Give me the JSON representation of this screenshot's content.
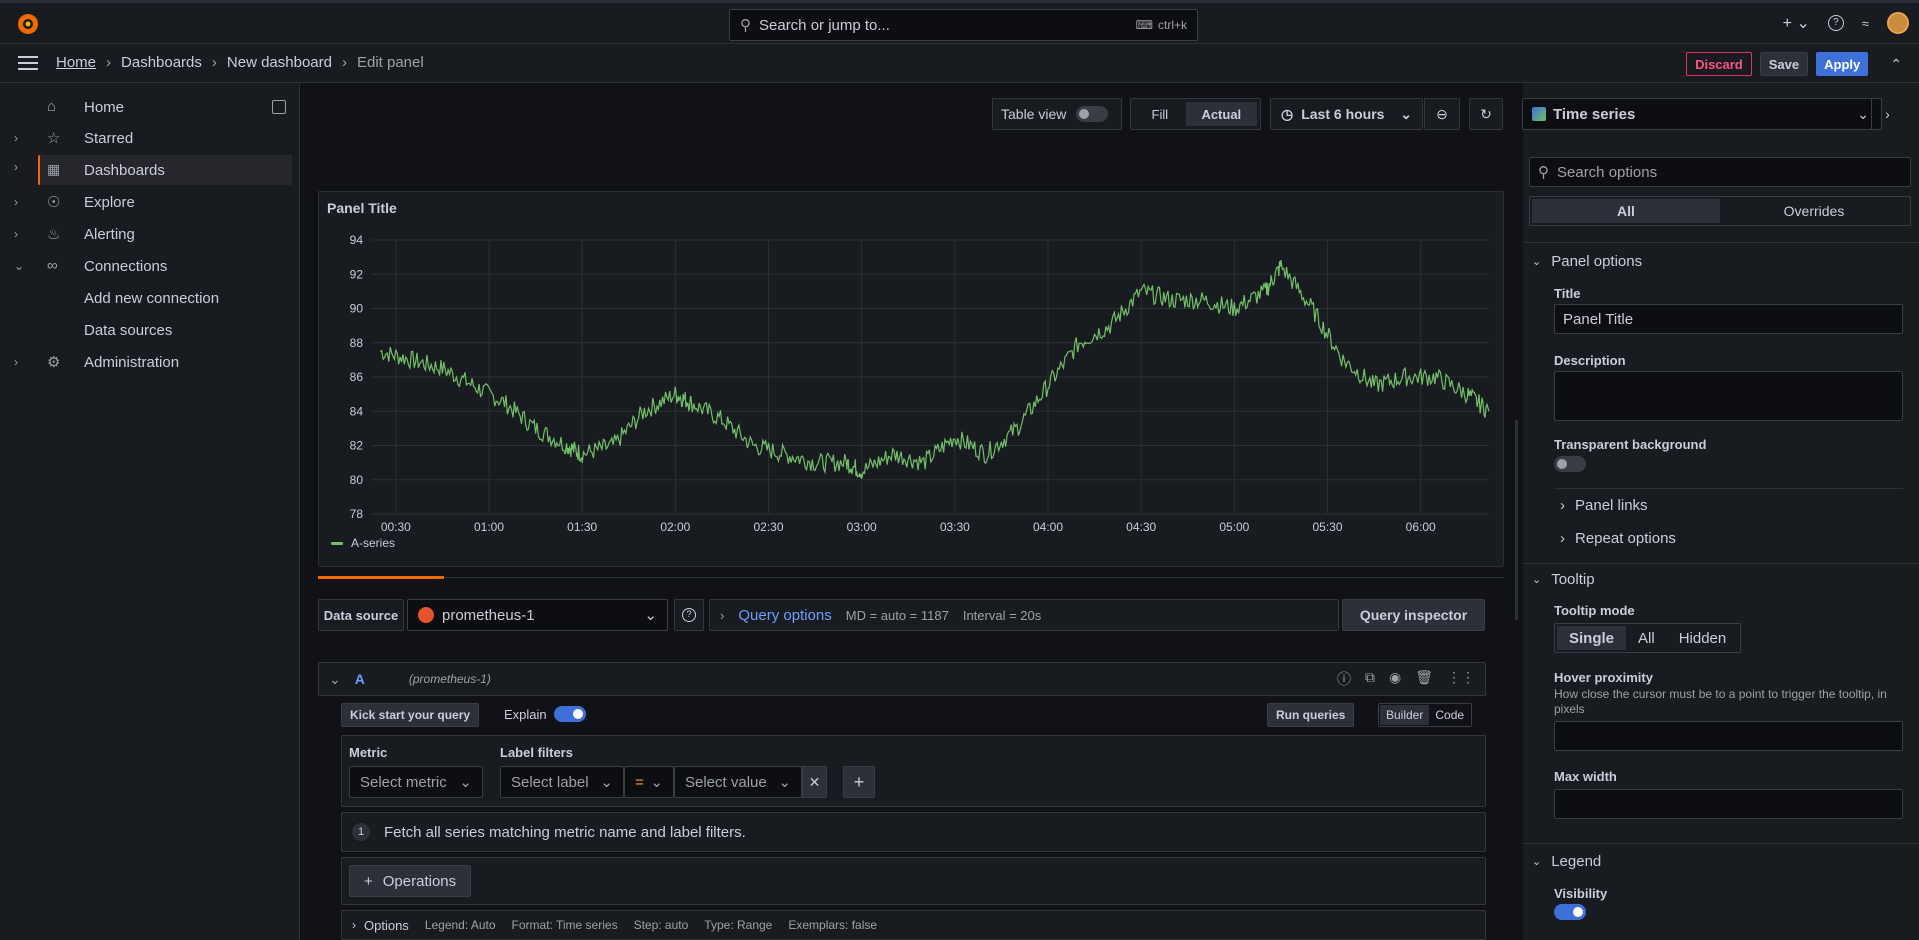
{
  "topbar": {
    "search_placeholder": "Search or jump to...",
    "search_shortcut": "ctrl+k"
  },
  "breadcrumbs": {
    "home": "Home",
    "dashboards": "Dashboards",
    "new_dashboard": "New dashboard",
    "edit_panel": "Edit panel"
  },
  "actions": {
    "discard": "Discard",
    "save": "Save",
    "apply": "Apply"
  },
  "sidebar": {
    "items": [
      {
        "label": "Home"
      },
      {
        "label": "Starred"
      },
      {
        "label": "Dashboards"
      },
      {
        "label": "Explore"
      },
      {
        "label": "Alerting"
      },
      {
        "label": "Connections"
      },
      {
        "label": "Add new connection"
      },
      {
        "label": "Data sources"
      },
      {
        "label": "Administration"
      }
    ]
  },
  "toolbar": {
    "table_view": "Table view",
    "fill": "Fill",
    "actual": "Actual",
    "time_range": "Last 6 hours"
  },
  "panel": {
    "title": "Panel Title"
  },
  "chart_data": {
    "type": "line",
    "title": "Panel Title",
    "xlabel": "",
    "ylabel": "",
    "ylim": [
      78,
      94
    ],
    "yticks": [
      78,
      80,
      82,
      84,
      86,
      88,
      90,
      92,
      94
    ],
    "xticks": [
      "00:30",
      "01:00",
      "01:30",
      "02:00",
      "02:30",
      "03:00",
      "03:30",
      "04:00",
      "04:30",
      "05:00",
      "05:30",
      "06:00"
    ],
    "series": [
      {
        "name": "A-series",
        "color": "#73bf69",
        "x": [
          "00:25",
          "00:35",
          "00:45",
          "00:55",
          "01:05",
          "01:15",
          "01:25",
          "01:30",
          "01:40",
          "01:50",
          "02:00",
          "02:05",
          "02:15",
          "02:25",
          "02:35",
          "02:45",
          "02:55",
          "03:00",
          "03:10",
          "03:20",
          "03:30",
          "03:40",
          "03:50",
          "04:00",
          "04:10",
          "04:20",
          "04:30",
          "04:40",
          "04:50",
          "05:00",
          "05:10",
          "05:15",
          "05:25",
          "05:35",
          "05:45",
          "05:55",
          "06:05",
          "06:15",
          "06:22"
        ],
        "values": [
          87.5,
          87,
          86.5,
          85.5,
          84.5,
          83,
          82,
          81.5,
          82,
          84,
          85,
          84.5,
          83.5,
          82,
          81.5,
          81,
          81,
          80.5,
          81.5,
          81,
          82.5,
          81.5,
          83,
          85.5,
          88,
          89,
          91,
          90.5,
          90.5,
          90,
          91,
          92.5,
          90,
          87,
          85.5,
          86,
          86,
          85,
          84
        ]
      }
    ]
  },
  "query": {
    "datasource_label": "Data source",
    "datasource": "prometheus-1",
    "query_options": "Query options",
    "md": "MD = auto = 1187",
    "interval": "Interval = 20s",
    "query_inspector": "Query inspector",
    "ref": "A",
    "ref_ds": "(prometheus-1)",
    "kick_start": "Kick start your query",
    "explain": "Explain",
    "run_queries": "Run queries",
    "builder": "Builder",
    "code": "Code",
    "metric_label": "Metric",
    "label_filters": "Label filters",
    "select_metric": "Select metric",
    "select_label": "Select label",
    "op": "=",
    "select_value": "Select value",
    "hint_num": "1",
    "hint": "Fetch all series matching metric name and label filters.",
    "operations": "Operations",
    "options": "Options",
    "legend": "Legend: Auto",
    "format": "Format: Time series",
    "step": "Step: auto",
    "qtype": "Type: Range",
    "exemplars": "Exemplars: false"
  },
  "right": {
    "viz": "Time series",
    "search_placeholder": "Search options",
    "tab_all": "All",
    "tab_overrides": "Overrides",
    "panel_options": "Panel options",
    "title_label": "Title",
    "title_value": "Panel Title",
    "description_label": "Description",
    "transparent": "Transparent background",
    "panel_links": "Panel links",
    "repeat_options": "Repeat options",
    "tooltip": "Tooltip",
    "tooltip_mode": "Tooltip mode",
    "single": "Single",
    "all": "All",
    "hidden": "Hidden",
    "hover_proximity": "Hover proximity",
    "hover_desc": "How close the cursor must be to a point to trigger the tooltip, in pixels",
    "max_width": "Max width",
    "legend": "Legend",
    "visibility": "Visibility"
  }
}
